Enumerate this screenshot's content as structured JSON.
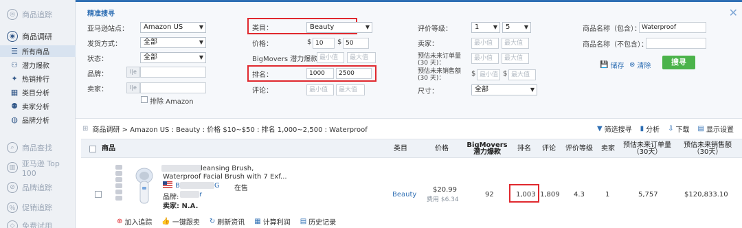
{
  "sidebar": {
    "items": [
      {
        "label": "商品追踪",
        "icon": "tracking-icon"
      },
      {
        "label": "商品调研",
        "icon": "research-icon"
      },
      {
        "label": "所有商品",
        "icon": "list-icon"
      },
      {
        "label": "潜力爆款",
        "icon": "potential-icon"
      },
      {
        "label": "热销排行",
        "icon": "hot-icon"
      },
      {
        "label": "类目分析",
        "icon": "category-icon"
      },
      {
        "label": "卖家分析",
        "icon": "seller-icon"
      },
      {
        "label": "品牌分析",
        "icon": "brand-icon"
      },
      {
        "label": "商品查找",
        "icon": "find-icon"
      },
      {
        "label": "亚马逊 Top 100",
        "icon": "top100-icon"
      },
      {
        "label": "品牌追踪",
        "icon": "brand-track-icon"
      },
      {
        "label": "促销追踪",
        "icon": "promo-icon"
      },
      {
        "label": "免费试用",
        "icon": "trial-icon"
      }
    ]
  },
  "filters": {
    "title": "精准搜寻",
    "site_label": "亚马逊站点：",
    "site_value": "Amazon US",
    "ship_label": "发货方式：",
    "ship_value": "全部",
    "status_label": "状态：",
    "status_value": "全部",
    "brand_label": "品牌：",
    "seller_label": "卖家：",
    "exclude_amazon": "排除 Amazon",
    "category_label": "类目：",
    "category_value": "Beauty",
    "price_label": "价格：",
    "price_min": "10",
    "price_max": "50",
    "bigmovers_label": "BigMovers 潜力爆款：",
    "min_ph": "最小值",
    "max_ph": "最大值",
    "rank_label": "排名：",
    "rank_min": "1000",
    "rank_max": "2500",
    "reviews_label": "评论：",
    "rating_label": "评价等级：",
    "rating_min": "1",
    "rating_max": "5",
    "sellers_label": "卖家：",
    "est_orders_label": "预估未来订单量 (30 天)：",
    "est_sales_label": "预估未来销售额 (30 天)：",
    "size_label": "尺寸：",
    "size_value": "全部",
    "name_incl_label": "商品名称（包含）：",
    "name_incl_value": "Waterproof",
    "name_excl_label": "商品名称（不包含）：",
    "save_label": "储存",
    "clear_label": "清除",
    "search_label": "搜寻",
    "dollar": "$"
  },
  "breadcrumb": "商品调研 > Amazon US : Beauty : 价格 $10~$50 : 排名 1,000~2,500 : Waterproof",
  "tools": [
    "筛选搜寻",
    "分析",
    "下载",
    "显示设置"
  ],
  "table": {
    "headers": {
      "product": "商品",
      "category": "类目",
      "price": "价格",
      "bigmovers": "BigMovers 潜力爆款",
      "rank": "排名",
      "reviews": "评论",
      "rating": "评价等级",
      "sellers": "卖家",
      "est_orders": "预估未来订单量 （30天）",
      "est_sales": "预估未来销售额 （30天）"
    },
    "row": {
      "title_line1": "leansing Brush,",
      "title_line2": "Waterproof Facial Brush with 7 Exf...",
      "seller_prefix": "B",
      "seller_suffix": "G",
      "stock": "在售",
      "brand_label": "品牌:",
      "brand_value": "r",
      "seller_label": "卖家: N.A.",
      "category": "Beauty",
      "price": "$20.99",
      "fee": "费用 $6.34",
      "bigmovers": "92",
      "rank": "1,003",
      "reviews": "1,809",
      "rating": "4.3",
      "sellers": "1",
      "est_orders": "5,757",
      "est_sales": "$120,833.10"
    },
    "actions": [
      "加入追踪",
      "一键跟卖",
      "刷新资讯",
      "计算利润",
      "历史记录"
    ]
  }
}
